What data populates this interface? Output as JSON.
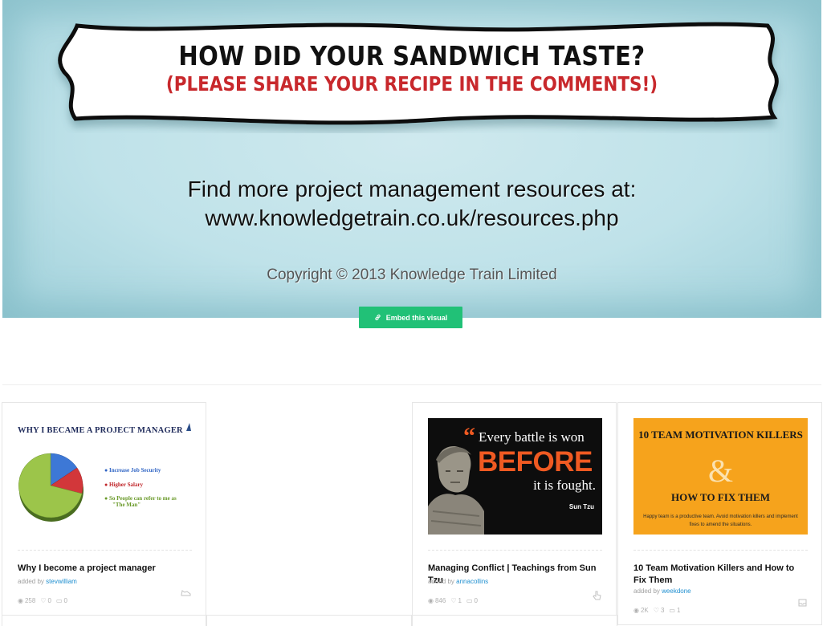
{
  "hero": {
    "banner_line1": "HOW DID YOUR SANDWICH TASTE?",
    "banner_line2": "(PLEASE SHARE YOUR RECIPE IN THE COMMENTS!)",
    "find_line1": "Find more project management resources at:",
    "find_line2": "www.knowledgetrain.co.uk/resources.php",
    "copyright": "Copyright © 2013 Knowledge Train Limited",
    "colors": {
      "background": "#bfe2e9",
      "banner_red": "#c8282c"
    }
  },
  "embed_button": {
    "label": "Embed this visual",
    "icon": "link-icon",
    "color": "#21c177"
  },
  "cards": [
    {
      "title": "Why I become a project manager",
      "added_by_prefix": "added by",
      "author": "stevwilliam",
      "views": "258",
      "likes": "0",
      "comments": "0",
      "corner_icon": "shoe-icon",
      "thumb": {
        "heading": "WHY I BECAME A PROJECT MANAGER",
        "legend": [
          "Increase Job Security",
          "Higher Salary",
          "So People can refer to me as",
          "\"The Man\""
        ],
        "colors": [
          "#2f64c4",
          "#c0262a",
          "#6a9a2a"
        ]
      }
    },
    {
      "title": "Managing Conflict | Teachings from Sun Tzu",
      "added_by_prefix": "added by",
      "author": "annacollins",
      "views": "846",
      "likes": "1",
      "comments": "0",
      "corner_icon": "pointer-hand-icon",
      "thumb": {
        "line1": "Every battle is won",
        "line2": "BEFORE",
        "line3": "it is fought.",
        "attribution": "Sun Tzu"
      }
    },
    {
      "title": "10 Team Motivation Killers and How to Fix Them",
      "added_by_prefix": "added by",
      "author": "weekdone",
      "views": "2K",
      "likes": "3",
      "comments": "1",
      "corner_icon": "envelope-icon",
      "thumb": {
        "heading1": "10 TEAM MOTIVATION KILLERS",
        "ampersand": "&",
        "heading2": "HOW TO FIX THEM",
        "subtitle": "Happy team is a productive team. Avoid motivation killers and implement fixes to amend the situations."
      }
    }
  ]
}
